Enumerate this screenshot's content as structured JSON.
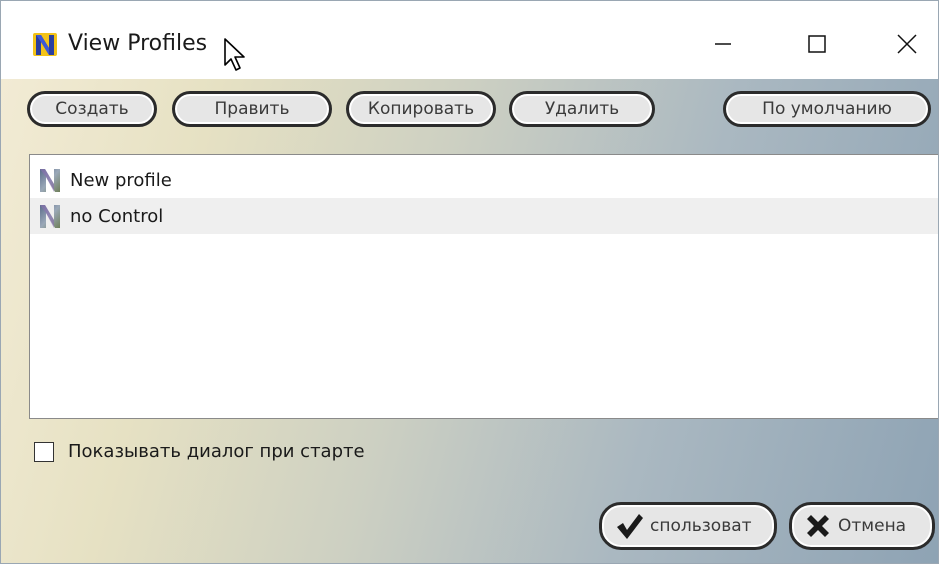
{
  "window": {
    "title": "View Profiles"
  },
  "toolbar": {
    "create_label": "Создать",
    "edit_label": "Править",
    "copy_label": "Копировать",
    "delete_label": "Удалить",
    "default_label": "По умолчанию"
  },
  "profiles": [
    {
      "label": "New profile",
      "icon": "profile-n-icon"
    },
    {
      "label": "no Control",
      "icon": "profile-n-icon"
    }
  ],
  "options": {
    "show_dialog_label": "Показывать диалог при старте",
    "show_dialog_checked": false
  },
  "footer": {
    "use_label": "спользоват",
    "cancel_label": "Отмена"
  },
  "colors": {
    "button_border": "#2b2b2b",
    "button_fill": "#e6e6e6",
    "selected_row": "#efefef"
  }
}
